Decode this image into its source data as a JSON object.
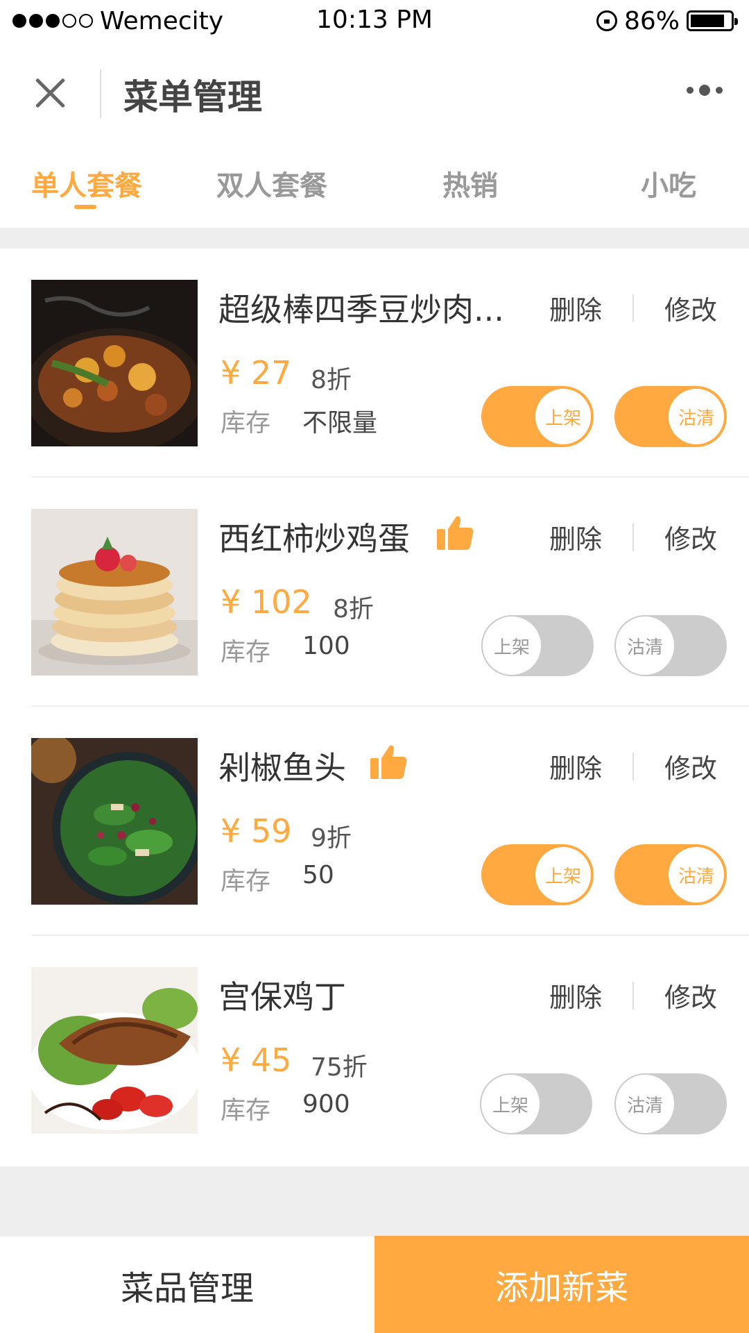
{
  "status_bar": {
    "carrier": "Wemecity",
    "time": "10:13 PM",
    "battery": "86%",
    "battery_level": 0.86
  },
  "header": {
    "title": "菜单管理",
    "close_icon": "close-icon",
    "more_icon": "more-icon"
  },
  "tabs": [
    {
      "label": "单人套餐",
      "active": true
    },
    {
      "label": "双人套餐",
      "active": false
    },
    {
      "label": "热销",
      "active": false
    },
    {
      "label": "小吃",
      "active": false
    }
  ],
  "labels": {
    "currency": "¥",
    "stock": "库存",
    "delete": "删除",
    "edit": "修改",
    "toggle_shelf": "上架",
    "toggle_clean": "沽清"
  },
  "items": [
    {
      "name": "超级棒四季豆炒肉...",
      "price": "¥ 27",
      "discount": "8折",
      "stock": "不限量",
      "thumbs_up": false,
      "shelf_on": true,
      "clean_on": true
    },
    {
      "name": "西红柿炒鸡蛋",
      "price": "¥ 102",
      "discount": "8折",
      "stock": "100",
      "thumbs_up": true,
      "shelf_on": false,
      "clean_on": false
    },
    {
      "name": "剁椒鱼头",
      "price": "¥ 59",
      "discount": "9折",
      "stock": "50",
      "thumbs_up": true,
      "shelf_on": true,
      "clean_on": true
    },
    {
      "name": "宫保鸡丁",
      "price": "¥ 45",
      "discount": "75折",
      "stock": "900",
      "thumbs_up": false,
      "shelf_on": false,
      "clean_on": false
    }
  ],
  "bottom_bar": {
    "manage": "菜品管理",
    "add": "添加新菜"
  },
  "colors": {
    "accent": "#ffa940",
    "toggle_off": "#cccccc",
    "background_gray": "#eeeeee"
  }
}
